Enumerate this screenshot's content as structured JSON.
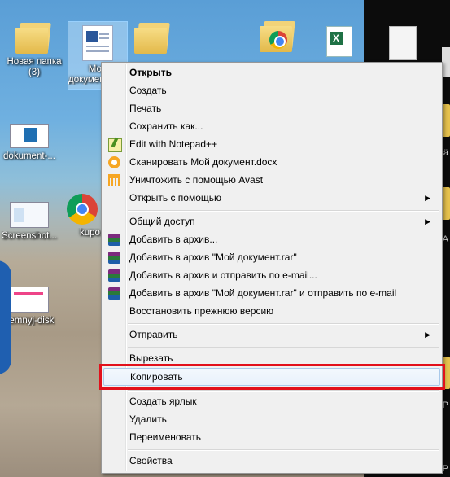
{
  "desktop": {
    "icons": [
      {
        "label": "Новая папка\n(3)"
      },
      {
        "label": "Мой документ.docx"
      },
      {
        "label": ""
      },
      {
        "label": ""
      },
      {
        "label": ""
      },
      {
        "label": "dokument-..."
      },
      {
        "label": "Screenshot..."
      },
      {
        "label": "kupo..."
      },
      {
        "label": "semnyj-disk"
      }
    ],
    "strip_texts": [
      "A",
      "ä",
      "o",
      "P",
      "P"
    ]
  },
  "menu": {
    "items": [
      {
        "label": "Открыть",
        "bold": true
      },
      {
        "label": "Создать"
      },
      {
        "label": "Печать"
      },
      {
        "label": "Сохранить как..."
      },
      {
        "label": "Edit with Notepad++",
        "icon": "notepad-plus-plus-icon"
      },
      {
        "label": "Сканировать Мой документ.docx",
        "icon": "avast-scan-icon"
      },
      {
        "label": "Уничтожить с помощью Avast",
        "icon": "avast-shredder-icon"
      },
      {
        "label": "Открыть с помощью",
        "submenu": true
      },
      {
        "label": "Общий доступ",
        "submenu": true
      },
      {
        "label": "Добавить в архив...",
        "icon": "winrar-icon"
      },
      {
        "label": "Добавить в архив \"Мой документ.rar\"",
        "icon": "winrar-icon"
      },
      {
        "label": "Добавить в архив и отправить по e-mail...",
        "icon": "winrar-icon"
      },
      {
        "label": "Добавить в архив \"Мой документ.rar\" и отправить по e-mail",
        "icon": "winrar-icon"
      },
      {
        "label": "Восстановить прежнюю версию"
      },
      {
        "label": "Отправить",
        "submenu": true
      },
      {
        "label": "Вырезать"
      },
      {
        "label": "Копировать",
        "highlighted": true
      },
      {
        "label": "Создать ярлык"
      },
      {
        "label": "Удалить"
      },
      {
        "label": "Переименовать"
      },
      {
        "label": "Свойства"
      }
    ],
    "highlight_color": "#e2101b"
  }
}
